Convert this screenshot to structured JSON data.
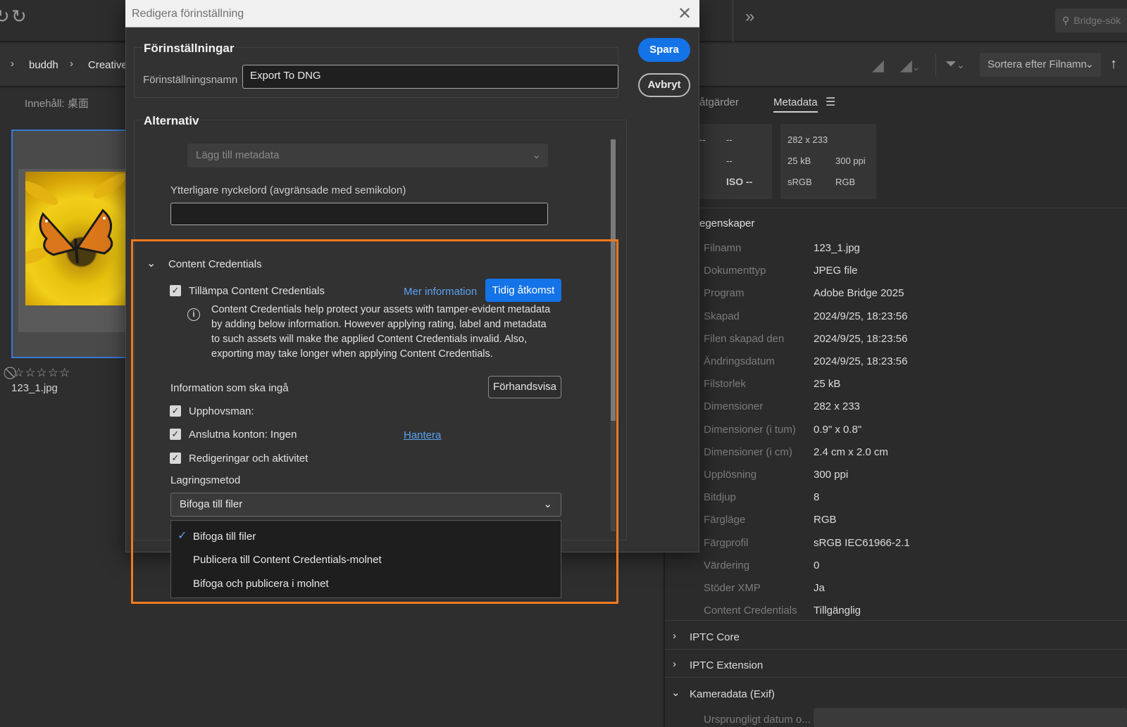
{
  "app": {
    "search_placeholder": "Bridge-sök",
    "breadcrumbs": [
      "buddh",
      "Creative"
    ],
    "sort_label": "Sortera efter Filnamn",
    "content_label": "Innehåll: 桌面",
    "thumbnail": {
      "filename": "123_1.jpg",
      "rating_stars": "⃠☆☆☆☆☆"
    }
  },
  "right_panel": {
    "tabs": {
      "actions": "åtgärder",
      "metadata": "Metadata"
    },
    "info_left": {
      "row1a": "--",
      "row1b": "--",
      "row2": "--",
      "iso": "ISO --"
    },
    "info_right": {
      "dims": "282 x 233",
      "size": "25 kB",
      "ppi": "300 ppi",
      "profile": "sRGB",
      "mode": "RGB"
    },
    "file_props_title": "egenskaper",
    "file_props": [
      {
        "label": "Filnamn",
        "value": "123_1.jpg"
      },
      {
        "label": "Dokumenttyp",
        "value": "JPEG file"
      },
      {
        "label": "Program",
        "value": "Adobe Bridge 2025"
      },
      {
        "label": "Skapad",
        "value": "2024/9/25, 18:23:56"
      },
      {
        "label": "Filen skapad den",
        "value": "2024/9/25, 18:23:56"
      },
      {
        "label": "Ändringsdatum",
        "value": "2024/9/25, 18:23:56"
      },
      {
        "label": "Filstorlek",
        "value": "25 kB"
      },
      {
        "label": "Dimensioner",
        "value": "282 x 233"
      },
      {
        "label": "Dimensioner (i tum)",
        "value": "0.9\" x 0.8\""
      },
      {
        "label": "Dimensioner (i cm)",
        "value": "2.4 cm x 2.0 cm"
      },
      {
        "label": "Upplösning",
        "value": "300 ppi"
      },
      {
        "label": "Bitdjup",
        "value": "8"
      },
      {
        "label": "Färgläge",
        "value": "RGB"
      },
      {
        "label": "Färgprofil",
        "value": "sRGB IEC61966-2.1"
      },
      {
        "label": "Värdering",
        "value": "0"
      },
      {
        "label": "Stöder XMP",
        "value": "Ja"
      },
      {
        "label": "Content Credentials",
        "value": "Tillgänglig"
      }
    ],
    "sections": {
      "iptc_core": "IPTC Core",
      "iptc_ext": "IPTC Extension",
      "camera": "Kameradata (Exif)"
    },
    "camera_first_label": "Ursprungligt datum o..."
  },
  "dialog": {
    "title": "Redigera förinställning",
    "presets_legend": "Förinställningar",
    "preset_name_label": "Förinställningsnamn",
    "preset_name_value": "Export To DNG",
    "save_label": "Spara",
    "cancel_label": "Avbryt",
    "options_legend": "Alternativ",
    "metadata_select": "Lägg till metadata",
    "keywords_label": "Ytterligare nyckelord (avgränsade med semikolon)",
    "keywords_value": "",
    "cc": {
      "title": "Content Credentials",
      "apply_label": "Tillämpa Content Credentials",
      "more_info": "Mer information",
      "early_access": "Tidig åtkomst",
      "info_text": "Content Credentials help protect your assets with tamper-evident metadata by adding below information. However applying rating, label and metadata to such assets will make the applied Content Credentials invalid. Also, exporting may take longer when applying Content Credentials.",
      "include_label": "Information som ska ingå",
      "preview_label": "Förhandsvisa",
      "creator_label": "Upphovsman:",
      "accounts_label": "Anslutna konton: Ingen",
      "manage_label": "Hantera",
      "edits_label": "Redigeringar och aktivitet",
      "storage_label": "Lagringsmetod",
      "storage_selected": "Bifoga till filer",
      "storage_options": [
        "Bifoga till filer",
        "Publicera till Content Credentials-molnet",
        "Bifoga och publicera i molnet"
      ]
    }
  }
}
